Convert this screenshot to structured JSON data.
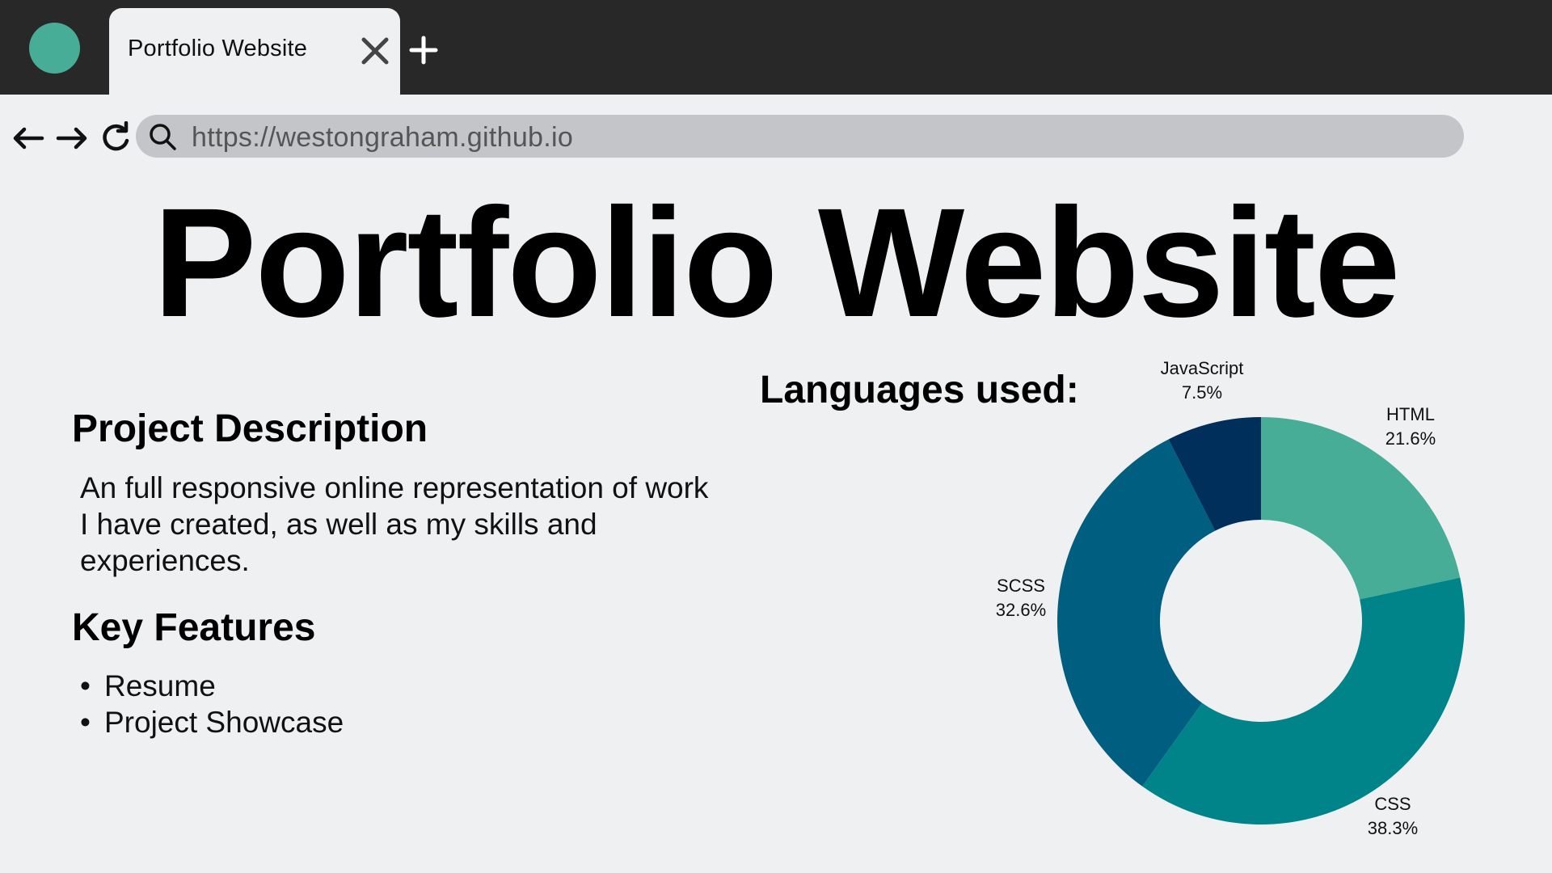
{
  "browser": {
    "tab_title": "Portfolio Website",
    "url": "https://westongraham.github.io",
    "accent_color": "#48ad96"
  },
  "page": {
    "title": "Portfolio Website",
    "description_heading": "Project Description",
    "description_text": "An full responsive online representation of work I have created, as well as my skills and experiences.",
    "features_heading": "Key Features",
    "features": [
      "Resume",
      "Project Showcase"
    ],
    "chart_heading": "Languages used:"
  },
  "chart_data": {
    "type": "pie",
    "donut": true,
    "categories": [
      "HTML",
      "CSS",
      "SCSS",
      "JavaScript"
    ],
    "values": [
      21.6,
      38.3,
      32.6,
      7.5
    ],
    "value_labels": [
      "21.6%",
      "38.3%",
      "32.6%",
      "7.5%"
    ],
    "colors": [
      "#48ad96",
      "#008489",
      "#005e80",
      "#002f5b"
    ],
    "title": "",
    "legend": "none"
  }
}
